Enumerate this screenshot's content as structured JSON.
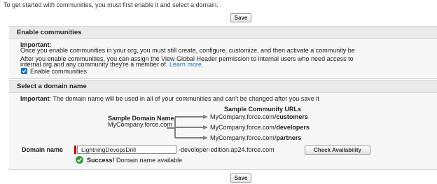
{
  "intro_text": "To get started with communities, you must first enable it and select a domain.",
  "save_top_label": "Save",
  "save_bottom_label": "Save",
  "enable_section": {
    "title": "Enable communities",
    "important_label": "Important:",
    "important_text": "Once you enable communities in your org, you must still create, configure, customize, and then activate a community be",
    "header_text_1": "After you enable communities, you can assign the View Global Header permission to internal users who need access to",
    "header_text_2": "internal org and any community they're a member of.",
    "learn_more": "Learn more.",
    "checkbox_label": "Enable communities",
    "checkbox_checked": true
  },
  "domain_section": {
    "title": "Select a domain name",
    "important_label": "Important",
    "important_text": ": The domain name will be used in all of your communities and can't be changed after you save it",
    "sample_domain_title": "Sample Domain Name",
    "sample_domain_value": "MyCompany.force.com",
    "sample_urls_title": "Sample Community URLs",
    "urls": [
      {
        "prefix": "MyCompany.force.com/",
        "path": "customers"
      },
      {
        "prefix": "MyCompany.force.com/",
        "path": "developers"
      },
      {
        "prefix": "MyCompany.force.com/",
        "path": "partners"
      }
    ],
    "domain_label": "Domain name",
    "domain_value": "LightningDevopsDrill",
    "domain_suffix": "-developer-edition.ap24.force.com",
    "check_button": "Check Availability",
    "success_label": "Success!",
    "success_text": "Domain name available"
  },
  "colors": {
    "checkbox": "#1a72d1",
    "success": "#2e9c3c",
    "link": "#1a6fc2",
    "required": "#c00000",
    "arrow": "#808080"
  }
}
